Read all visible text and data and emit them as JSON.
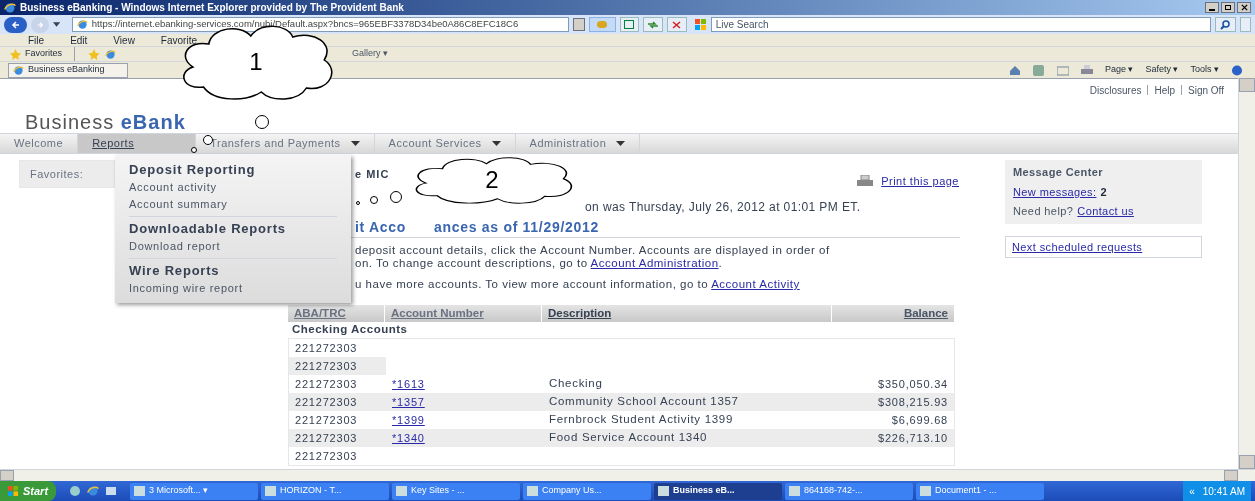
{
  "window": {
    "title": "Business eBanking - Windows Internet Explorer provided by The Provident Bank"
  },
  "address_bar": {
    "url": "https://internet.ebanking-services.com/nubi/Default.aspx?bncs=965EBF3378D34be0A86C8EFC18C6",
    "search_placeholder": "Live Search"
  },
  "menu_bar": [
    "File",
    "Edit",
    "View",
    "Favorite"
  ],
  "favorites_bar": {
    "label": "Favorites",
    "gallery": "Gallery ▾"
  },
  "tab": {
    "title": "Business eBanking"
  },
  "command_bar": [
    "Page ▾",
    "Safety ▾",
    "Tools ▾"
  ],
  "header": {
    "brand_plain": "Business",
    "brand_accent": "eBank",
    "links": [
      "Disclosures",
      "Help",
      "Sign Off"
    ]
  },
  "nav": [
    {
      "label": "Welcome",
      "selected": false,
      "dropdown": false
    },
    {
      "label": "Reports",
      "selected": true,
      "dropdown": false
    },
    {
      "label": "Transfers and Payments",
      "selected": false,
      "dropdown": true
    },
    {
      "label": "Account Services",
      "selected": false,
      "dropdown": true
    },
    {
      "label": "Administration",
      "selected": false,
      "dropdown": true
    }
  ],
  "favorites_panel": {
    "label": "Favorites:"
  },
  "reports_menu": [
    {
      "heading": "Deposit Reporting",
      "items": [
        "Account activity",
        "Account summary"
      ]
    },
    {
      "heading": "Downloadable Reports",
      "items": [
        "Download report"
      ]
    },
    {
      "heading": "Wire Reports",
      "items": [
        "Incoming wire report"
      ]
    }
  ],
  "main": {
    "welcome": "e MIC",
    "print_link": "Print this page",
    "last_login": "on was Thursday, July 26, 2012 at 01:01 PM ET.",
    "title_parts": [
      "it Acco",
      "ances as of 11/29/2012"
    ],
    "paragraphs": [
      {
        "lines": [
          "deposit account details, click the Account Number. Accounts are displayed in order of",
          "on. To change account descriptions, go to"
        ],
        "link": "Account Administration",
        "after": "."
      },
      {
        "lines": [
          "u have more accounts. To view more account information, go to"
        ],
        "link": "Account Activity"
      }
    ]
  },
  "table": {
    "columns": [
      "ABA/TRC",
      "Account Number",
      "Description",
      "Balance"
    ],
    "group": "Checking Accounts",
    "rows": [
      {
        "aba": "221272303"
      },
      {
        "aba": "221272303"
      },
      {
        "aba": "221272303",
        "account": "*1613",
        "description": "Checking",
        "balance": "$350,050.34"
      },
      {
        "aba": "221272303",
        "account": "*1357",
        "description": "Community School Account 1357",
        "balance": "$308,215.93"
      },
      {
        "aba": "221272303",
        "account": "*1399",
        "description": "Fernbrock Student Activity 1399",
        "balance": "$6,699.68"
      },
      {
        "aba": "221272303",
        "account": "*1340",
        "description": "Food Service Account 1340",
        "balance": "$226,713.10"
      },
      {
        "aba": "221272303"
      }
    ]
  },
  "message_center": {
    "title": "Message Center",
    "new_messages_link": "New messages:",
    "new_messages_count": "2",
    "help_text": "Need help?",
    "help_link": "Contact us",
    "scheduled_link": "Next scheduled requests"
  },
  "callouts": [
    {
      "number": "1"
    },
    {
      "number": "2"
    }
  ],
  "taskbar": {
    "start": "Start",
    "items": [
      {
        "label": "3 Microsoft... ▾",
        "selected": false
      },
      {
        "label": "HORIZON - T...",
        "selected": false
      },
      {
        "label": "Key Sites - ...",
        "selected": false
      },
      {
        "label": "Company Us...",
        "selected": false
      },
      {
        "label": "Business eB...",
        "selected": true
      },
      {
        "label": "864168-742-...",
        "selected": false
      },
      {
        "label": "Document1 - ...",
        "selected": false
      }
    ],
    "tray": "«",
    "clock": "10:41 AM"
  }
}
